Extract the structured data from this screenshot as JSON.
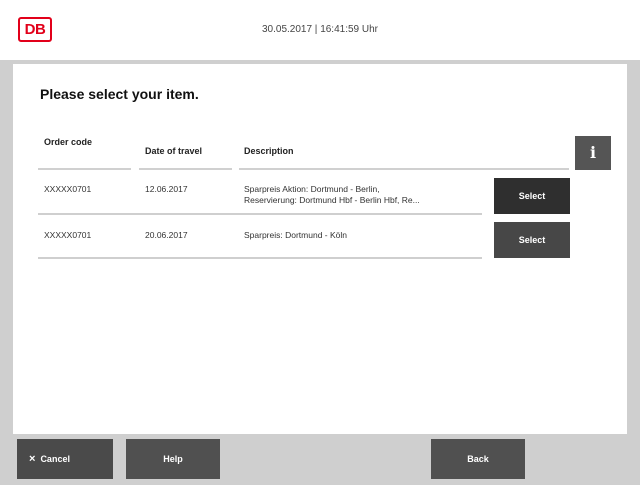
{
  "header": {
    "logo_text": "DB",
    "datetime": "30.05.2017 | 16:41:59 Uhr"
  },
  "page": {
    "title": "Please select your item."
  },
  "table": {
    "columns": [
      "Order code",
      "Date of travel",
      "Description"
    ],
    "info_label": "i",
    "rows": [
      {
        "order_code": "XXXXX0701",
        "date": "12.06.2017",
        "description_line1": "Sparpreis Aktion: Dortmund - Berlin,",
        "description_line2": "Reservierung: Dortmund Hbf - Berlin Hbf, Re...",
        "select_label": "Select"
      },
      {
        "order_code": "XXXXX0701",
        "date": "20.06.2017",
        "description_line1": "Sparpreis: Dortmund - Köln",
        "description_line2": "",
        "select_label": "Select"
      }
    ]
  },
  "footer": {
    "cancel_label": "Cancel",
    "cancel_icon": "×",
    "help_label": "Help",
    "back_label": "Back"
  },
  "colors": {
    "brand_red": "#e2001a",
    "button_dark": "#474747"
  }
}
